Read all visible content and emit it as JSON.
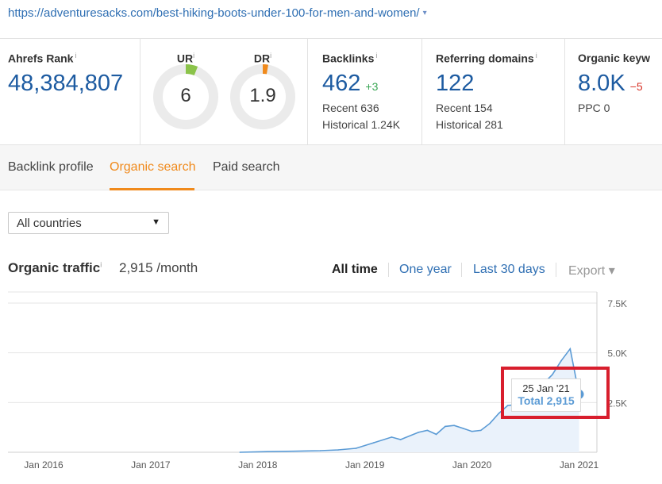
{
  "url": {
    "text": "https://adventuresacks.com/best-hiking-boots-under-100-for-men-and-women/",
    "caret": "▾"
  },
  "metrics": {
    "ahrefs_rank": {
      "title": "Ahrefs Rank",
      "info": "i",
      "value": "48,384,807"
    },
    "ur": {
      "title": "UR",
      "info": "i",
      "value": "6",
      "gauge_level": 6,
      "color": "#8bc34a"
    },
    "dr": {
      "title": "DR",
      "info": "i",
      "value": "1.9",
      "gauge_level": 1.9,
      "color": "#f08a1c"
    },
    "backlinks": {
      "title": "Backlinks",
      "info": "i",
      "value": "462",
      "delta": "+3",
      "recent": "Recent 636",
      "historical": "Historical 1.24K"
    },
    "referring_domains": {
      "title": "Referring domains",
      "info": "i",
      "value": "122",
      "recent": "Recent 154",
      "historical": "Historical 281"
    },
    "organic_keywords": {
      "title": "Organic keyw",
      "info": "",
      "value": "8.0K",
      "delta": "−5",
      "ppc": "PPC 0"
    }
  },
  "tabs": [
    {
      "label": "Backlink profile",
      "active": false
    },
    {
      "label": "Organic search",
      "active": true
    },
    {
      "label": "Paid search",
      "active": false
    }
  ],
  "country_select": {
    "selected": "All countries",
    "arrow": "▼"
  },
  "organic_traffic": {
    "title": "Organic traffic",
    "info": "i",
    "value": "2,915 /month",
    "ranges": [
      "All time",
      "One year",
      "Last 30 days"
    ],
    "selected_range": "All time",
    "export": "Export ▾"
  },
  "tooltip": {
    "date": "25 Jan '21",
    "total": "Total 2,915"
  },
  "colors": {
    "accent": "#f08a1c",
    "link": "#2f6fb3",
    "line": "#5b9bd5",
    "highlight": "#d81e2d"
  },
  "chart_data": {
    "type": "area",
    "series": [
      {
        "x": [
          "2017-11",
          "2018-02",
          "2018-05",
          "2018-08",
          "2018-10",
          "2018-12",
          "2019-02",
          "2019-04",
          "2019-05",
          "2019-07",
          "2019-08",
          "2019-09",
          "2019-10",
          "2019-11",
          "2019-12",
          "2020-01",
          "2020-02",
          "2020-03",
          "2020-04",
          "2020-05",
          "2020-06",
          "2020-07",
          "2020-08",
          "2020-09",
          "2020-10",
          "2020-11",
          "2020-12",
          "2021-01"
        ],
        "values": [
          0,
          30,
          50,
          80,
          120,
          200,
          480,
          760,
          640,
          1000,
          1100,
          900,
          1300,
          1350,
          1200,
          1050,
          1100,
          1450,
          1950,
          2350,
          2400,
          2650,
          2500,
          3450,
          3900,
          4600,
          5200,
          2915
        ]
      }
    ],
    "xticks": [
      "Jan 2016",
      "Jan 2017",
      "Jan 2018",
      "Jan 2019",
      "Jan 2020",
      "Jan 2021"
    ],
    "yticks": [
      "2.5K",
      "5.0K",
      "7.5K"
    ],
    "xlim": [
      "2015-09",
      "2021-03"
    ],
    "ylim": [
      0,
      7500
    ],
    "grid": true
  }
}
